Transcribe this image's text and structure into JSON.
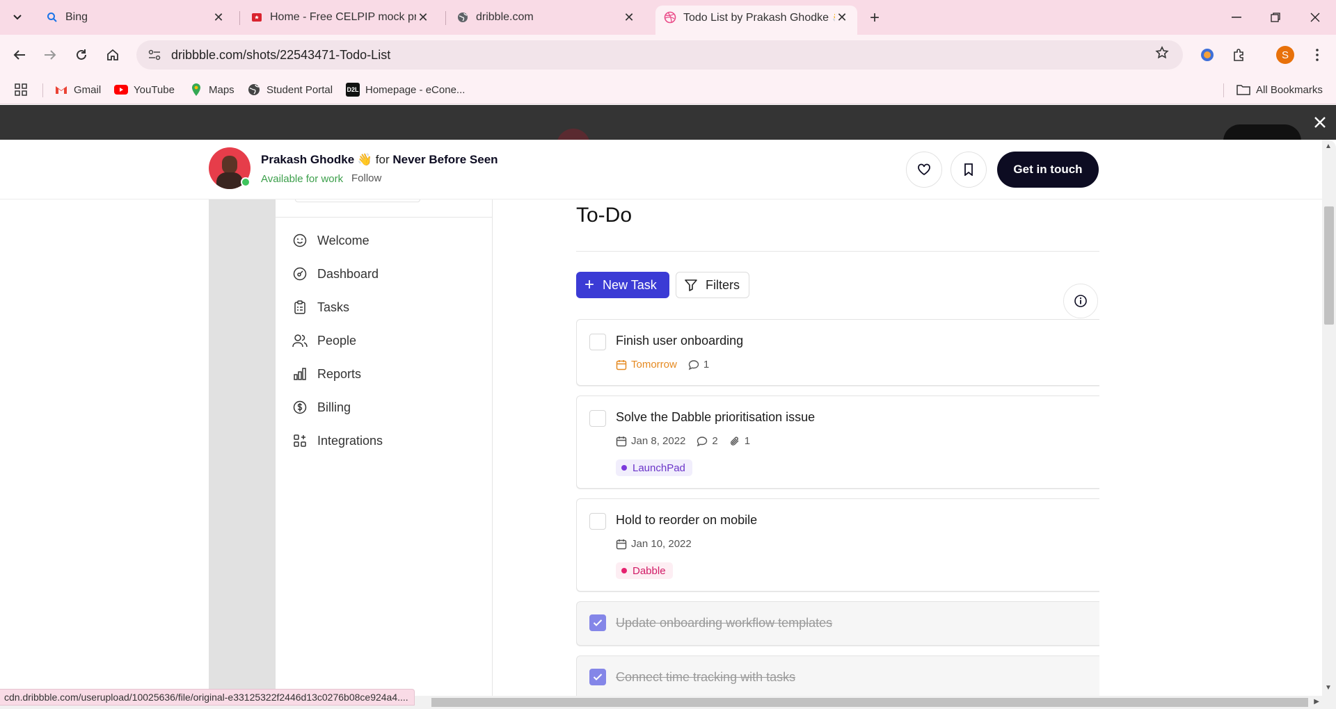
{
  "browser": {
    "tabs": [
      {
        "title": "Bing",
        "icon": "search-icon"
      },
      {
        "title": "Home - Free CELPIP mock practi",
        "icon": "celpip-icon"
      },
      {
        "title": "dribble.com",
        "icon": "globe-icon"
      },
      {
        "title": "Todo List by Prakash Ghodke 👋",
        "icon": "dribbble-icon",
        "active": true
      }
    ],
    "url": "dribbble.com/shots/22543471-Todo-List",
    "profile_initial": "S",
    "bookmarks": [
      {
        "label": "Gmail",
        "icon": "gmail-icon"
      },
      {
        "label": "YouTube",
        "icon": "youtube-icon"
      },
      {
        "label": "Maps",
        "icon": "maps-icon"
      },
      {
        "label": "Student Portal",
        "icon": "globe-icon"
      },
      {
        "label": "Homepage - eCone...",
        "icon": "d2l-icon"
      }
    ],
    "d2l_badge": "D2L",
    "all_bookmarks": "All Bookmarks",
    "status_url": "cdn.dribbble.com/userupload/10025636/file/original-e33125322f2446d13c0276b08ce924a4...."
  },
  "shot_header": {
    "designer": "Prakash Ghodke 👋",
    "for_word": "for",
    "team": "Never Before Seen",
    "availability": "Available for work",
    "follow": "Follow",
    "cta": "Get in touch"
  },
  "app": {
    "nav": [
      {
        "label": "Welcome",
        "icon": "smiley-icon"
      },
      {
        "label": "Dashboard",
        "icon": "gauge-icon"
      },
      {
        "label": "Tasks",
        "icon": "clipboard-icon"
      },
      {
        "label": "People",
        "icon": "people-icon"
      },
      {
        "label": "Reports",
        "icon": "bar-chart-icon"
      },
      {
        "label": "Billing",
        "icon": "dollar-icon"
      },
      {
        "label": "Integrations",
        "icon": "grid-plus-icon"
      }
    ],
    "title": "To-Do",
    "new_task": "New Task",
    "filters": "Filters",
    "tasks": [
      {
        "title": "Finish user onboarding",
        "due": "Tomorrow",
        "comments": "1",
        "done": false
      },
      {
        "title": "Solve the Dabble prioritisation issue",
        "due": "Jan 8, 2022",
        "comments": "2",
        "attachments": "1",
        "tag": "LaunchPad",
        "done": false
      },
      {
        "title": "Hold to reorder on mobile",
        "due": "Jan 10, 2022",
        "tag": "Dabble",
        "done": false
      },
      {
        "title": "Update onboarding workflow templates",
        "done": true
      },
      {
        "title": "Connect time tracking with tasks",
        "done": true
      }
    ]
  },
  "colors": {
    "primary": "#3b3bd5",
    "cta": "#0d0c22",
    "available": "#3c9f4b",
    "due_soon": "#e58a22",
    "tag_launchpad": "#7c3bdc",
    "tag_dabble": "#e5226f",
    "checked": "#8486e8"
  }
}
